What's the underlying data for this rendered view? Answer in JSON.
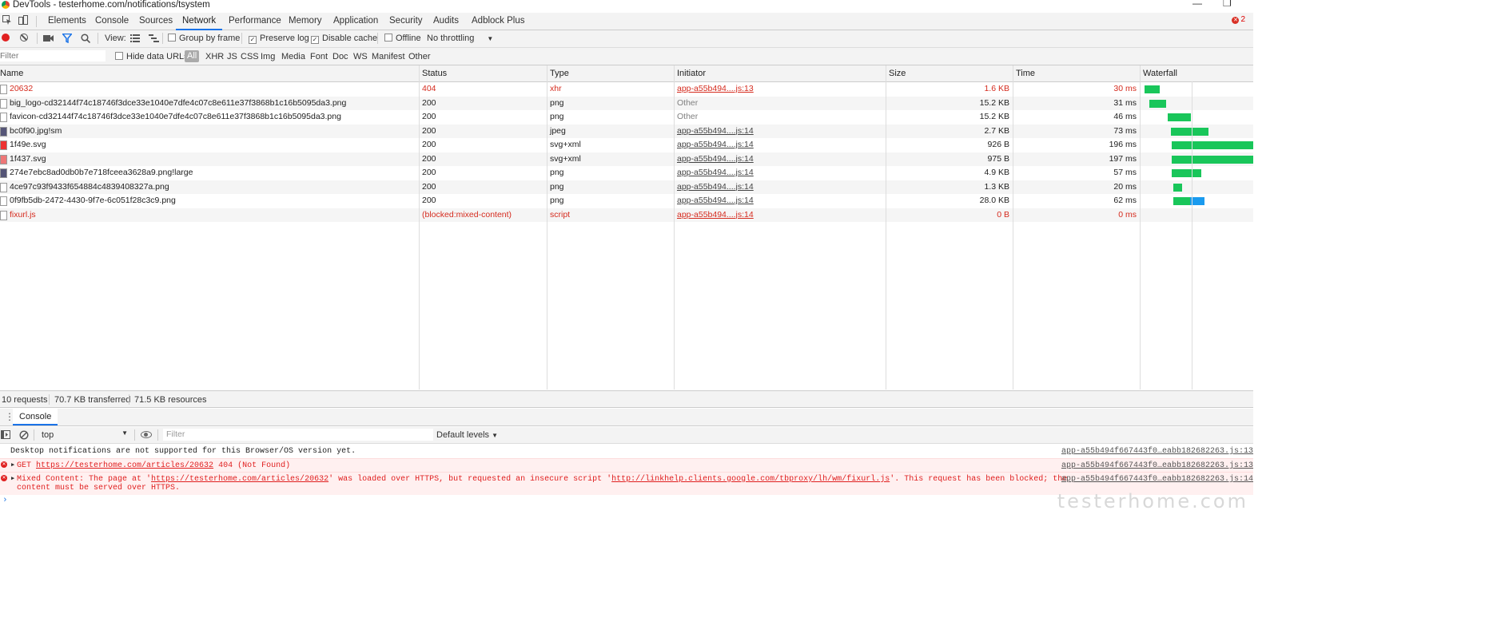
{
  "window": {
    "title": "DevTools - testerhome.com/notifications/tsystem"
  },
  "tabs": [
    "Elements",
    "Console",
    "Sources",
    "Network",
    "Performance",
    "Memory",
    "Application",
    "Security",
    "Audits",
    "Adblock Plus"
  ],
  "active_tab": "Network",
  "error_count": "2",
  "toolbar": {
    "view_label": "View:",
    "group_by_frame": "Group by frame",
    "preserve_log": "Preserve log",
    "disable_cache": "Disable cache",
    "offline": "Offline",
    "throttling": "No throttling"
  },
  "filterbar": {
    "placeholder": "Filter",
    "hide_data_urls": "Hide data URLs",
    "types": [
      "All",
      "XHR",
      "JS",
      "CSS",
      "Img",
      "Media",
      "Font",
      "Doc",
      "WS",
      "Manifest",
      "Other"
    ]
  },
  "columns": [
    "Name",
    "Status",
    "Type",
    "Initiator",
    "Size",
    "Time",
    "Waterfall"
  ],
  "rows": [
    {
      "name": "20632",
      "status": "404",
      "type": "xhr",
      "initiator": "app-a55b494....js:13",
      "size": "1.6 KB",
      "time": "30 ms",
      "error": true
    },
    {
      "name": "big_logo-cd32144f74c18746f3dce33e1040e7dfe4c07c8e611e37f3868b1c16b5095da3.png",
      "status": "200",
      "type": "png",
      "initiator": "Other",
      "size": "15.2 KB",
      "time": "31 ms"
    },
    {
      "name": "favicon-cd32144f74c18746f3dce33e1040e7dfe4c07c8e611e37f3868b1c16b5095da3.png",
      "status": "200",
      "type": "png",
      "initiator": "Other",
      "size": "15.2 KB",
      "time": "46 ms"
    },
    {
      "name": "bc0f90.jpg!sm",
      "status": "200",
      "type": "jpeg",
      "initiator": "app-a55b494....js:14",
      "size": "2.7 KB",
      "time": "73 ms"
    },
    {
      "name": "1f49e.svg",
      "status": "200",
      "type": "svg+xml",
      "initiator": "app-a55b494....js:14",
      "size": "926 B",
      "time": "196 ms"
    },
    {
      "name": "1f437.svg",
      "status": "200",
      "type": "svg+xml",
      "initiator": "app-a55b494....js:14",
      "size": "975 B",
      "time": "197 ms"
    },
    {
      "name": "274e7ebc8ad0db0b7e718fceea3628a9.png!large",
      "status": "200",
      "type": "png",
      "initiator": "app-a55b494....js:14",
      "size": "4.9 KB",
      "time": "57 ms"
    },
    {
      "name": "4ce97c93f9433f654884c4839408327a.png",
      "status": "200",
      "type": "png",
      "initiator": "app-a55b494....js:14",
      "size": "1.3 KB",
      "time": "20 ms"
    },
    {
      "name": "0f9fb5db-2472-4430-9f7e-6c051f28c3c9.png",
      "status": "200",
      "type": "png",
      "initiator": "app-a55b494....js:14",
      "size": "28.0 KB",
      "time": "62 ms"
    },
    {
      "name": "fixurl.js",
      "status": "(blocked:mixed-content)",
      "type": "script",
      "initiator": "app-a55b494....js:14",
      "size": "0 B",
      "time": "0 ms",
      "error": true
    }
  ],
  "summary": {
    "requests": "10 requests",
    "transferred": "70.7 KB transferred",
    "resources": "71.5 KB resources"
  },
  "drawer": {
    "tab": "Console"
  },
  "console": {
    "context": "top",
    "filter_placeholder": "Filter",
    "levels": "Default levels",
    "messages": [
      {
        "text": "Desktop notifications are not supported for this Browser/OS version yet.",
        "source": "app-a55b494f667443f0…eabb182682263.js:13"
      },
      {
        "prefix": "GET ",
        "url": "https://testerhome.com/articles/20632",
        "suffix": " 404 (Not Found)",
        "source": "app-a55b494f667443f0…eabb182682263.js:13"
      },
      {
        "part1": "Mixed Content: The page at '",
        "url1": "https://testerhome.com/articles/20632",
        "part2": "' was loaded over HTTPS, but requested an insecure script '",
        "url2": "http://linkhelp.clients.google.com/tbproxy/lh/wm/fixurl.js",
        "part3": "'. This request has been blocked; the content must be served over HTTPS.",
        "source": "app-a55b494f667443f0…eabb182682263.js:14"
      }
    ]
  },
  "watermark": "testerhome.com"
}
